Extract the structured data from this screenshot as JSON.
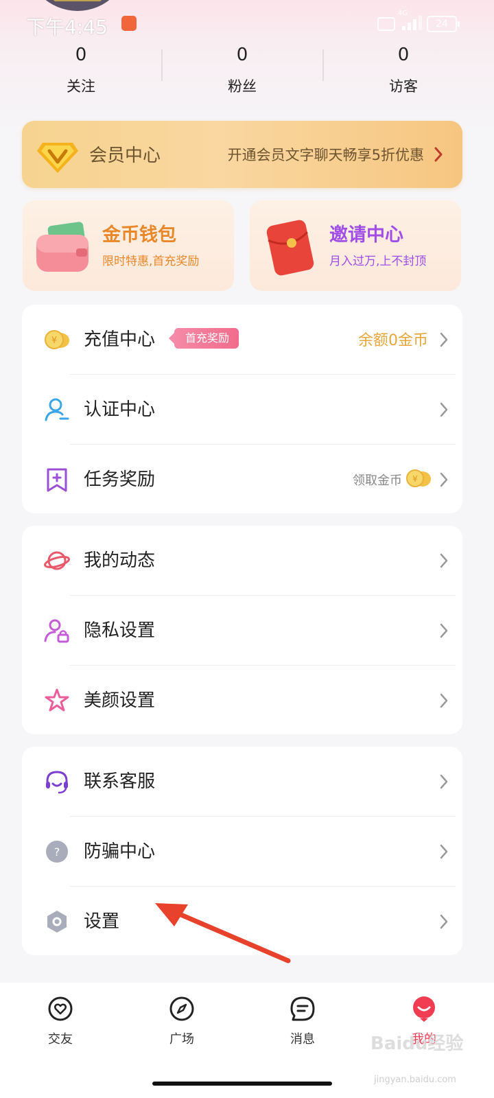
{
  "status_bar": {
    "time": "下午4:45",
    "network": "4G",
    "battery": "24"
  },
  "stats": [
    {
      "count": "0",
      "label": "关注"
    },
    {
      "count": "0",
      "label": "粉丝"
    },
    {
      "count": "0",
      "label": "访客"
    }
  ],
  "vip_banner": {
    "title": "会员中心",
    "promo": "开通会员文字聊天畅享5折优惠"
  },
  "wallet_card": {
    "title": "金币钱包",
    "subtitle": "限时特惠,首充奖励"
  },
  "invite_card": {
    "title": "邀请中心",
    "subtitle": "月入过万,上不封顶"
  },
  "menu_group_1": [
    {
      "label": "充值中心",
      "badge": "首充奖励",
      "value": "余额0金币"
    },
    {
      "label": "认证中心"
    },
    {
      "label": "任务奖励",
      "value": "领取金币"
    }
  ],
  "menu_group_2": [
    {
      "label": "我的动态"
    },
    {
      "label": "隐私设置"
    },
    {
      "label": "美颜设置"
    }
  ],
  "menu_group_3": [
    {
      "label": "联系客服"
    },
    {
      "label": "防骗中心"
    },
    {
      "label": "设置"
    }
  ],
  "bottom_nav": [
    {
      "label": "交友",
      "icon": "heart-chat-icon"
    },
    {
      "label": "广场",
      "icon": "compass-icon"
    },
    {
      "label": "消息",
      "icon": "message-icon"
    },
    {
      "label": "我的",
      "icon": "profile-icon",
      "active": true
    }
  ],
  "watermark": {
    "brand": "Baidu经验",
    "url": "jingyan.baidu.com"
  },
  "colors": {
    "accent": "#f23c52",
    "vip_gold": "#f6d38f",
    "wallet_orange": "#e9882a",
    "invite_purple": "#a14ee6",
    "balance_gold": "#e7a63c",
    "annotation_red": "#e8412c"
  }
}
